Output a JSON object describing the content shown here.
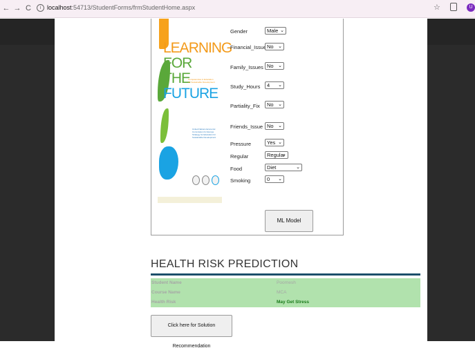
{
  "browser": {
    "back_icon": "←",
    "forward_icon": "→",
    "reload_icon": "C",
    "url_host": "localhost",
    "url_path": ":54713/StudentForms/frmStudentHome.aspx",
    "profile_initial": "U"
  },
  "poster": {
    "title_line1": "LEARNING",
    "title_line2": "FOR",
    "title_line3": "THE",
    "title_line4": "FUTURE",
    "subtitle": "Competencies in Education for Sustainable Development",
    "small_text": "United Nations Economic Commission for Europe Strategy for Education for Sustainable Development"
  },
  "form": {
    "fields": [
      {
        "label": "Gender",
        "value": "Male"
      },
      {
        "label": "Financial_Issues",
        "value": "No"
      },
      {
        "label": "Family_Issues",
        "value": "No"
      },
      {
        "label": "Study_Hours",
        "value": "4"
      },
      {
        "label": "Partiality_Fix",
        "value": "No"
      },
      {
        "label": "Friends_Issue",
        "value": "No"
      },
      {
        "label": "Pressure",
        "value": "Yes"
      },
      {
        "label": "Regular",
        "value": "Regular"
      },
      {
        "label": "Food",
        "value": "Diet"
      },
      {
        "label": "Smoking",
        "value": "0"
      }
    ],
    "ml_button_label": "ML Model"
  },
  "prediction": {
    "title": "HEALTH RISK PREDICTION",
    "rows": [
      {
        "key": "Student Name",
        "value": "Poornesh"
      },
      {
        "key": "Course Name",
        "value": "MCA"
      },
      {
        "key": "Health Risk",
        "value": "May Get Stress"
      }
    ],
    "solution_button_label": "Click here for Solution Recommendation"
  },
  "colors": {
    "result_bg": "#b1e2ad",
    "rule": "#1c4f6b",
    "risk_text": "#1a7a1a"
  }
}
